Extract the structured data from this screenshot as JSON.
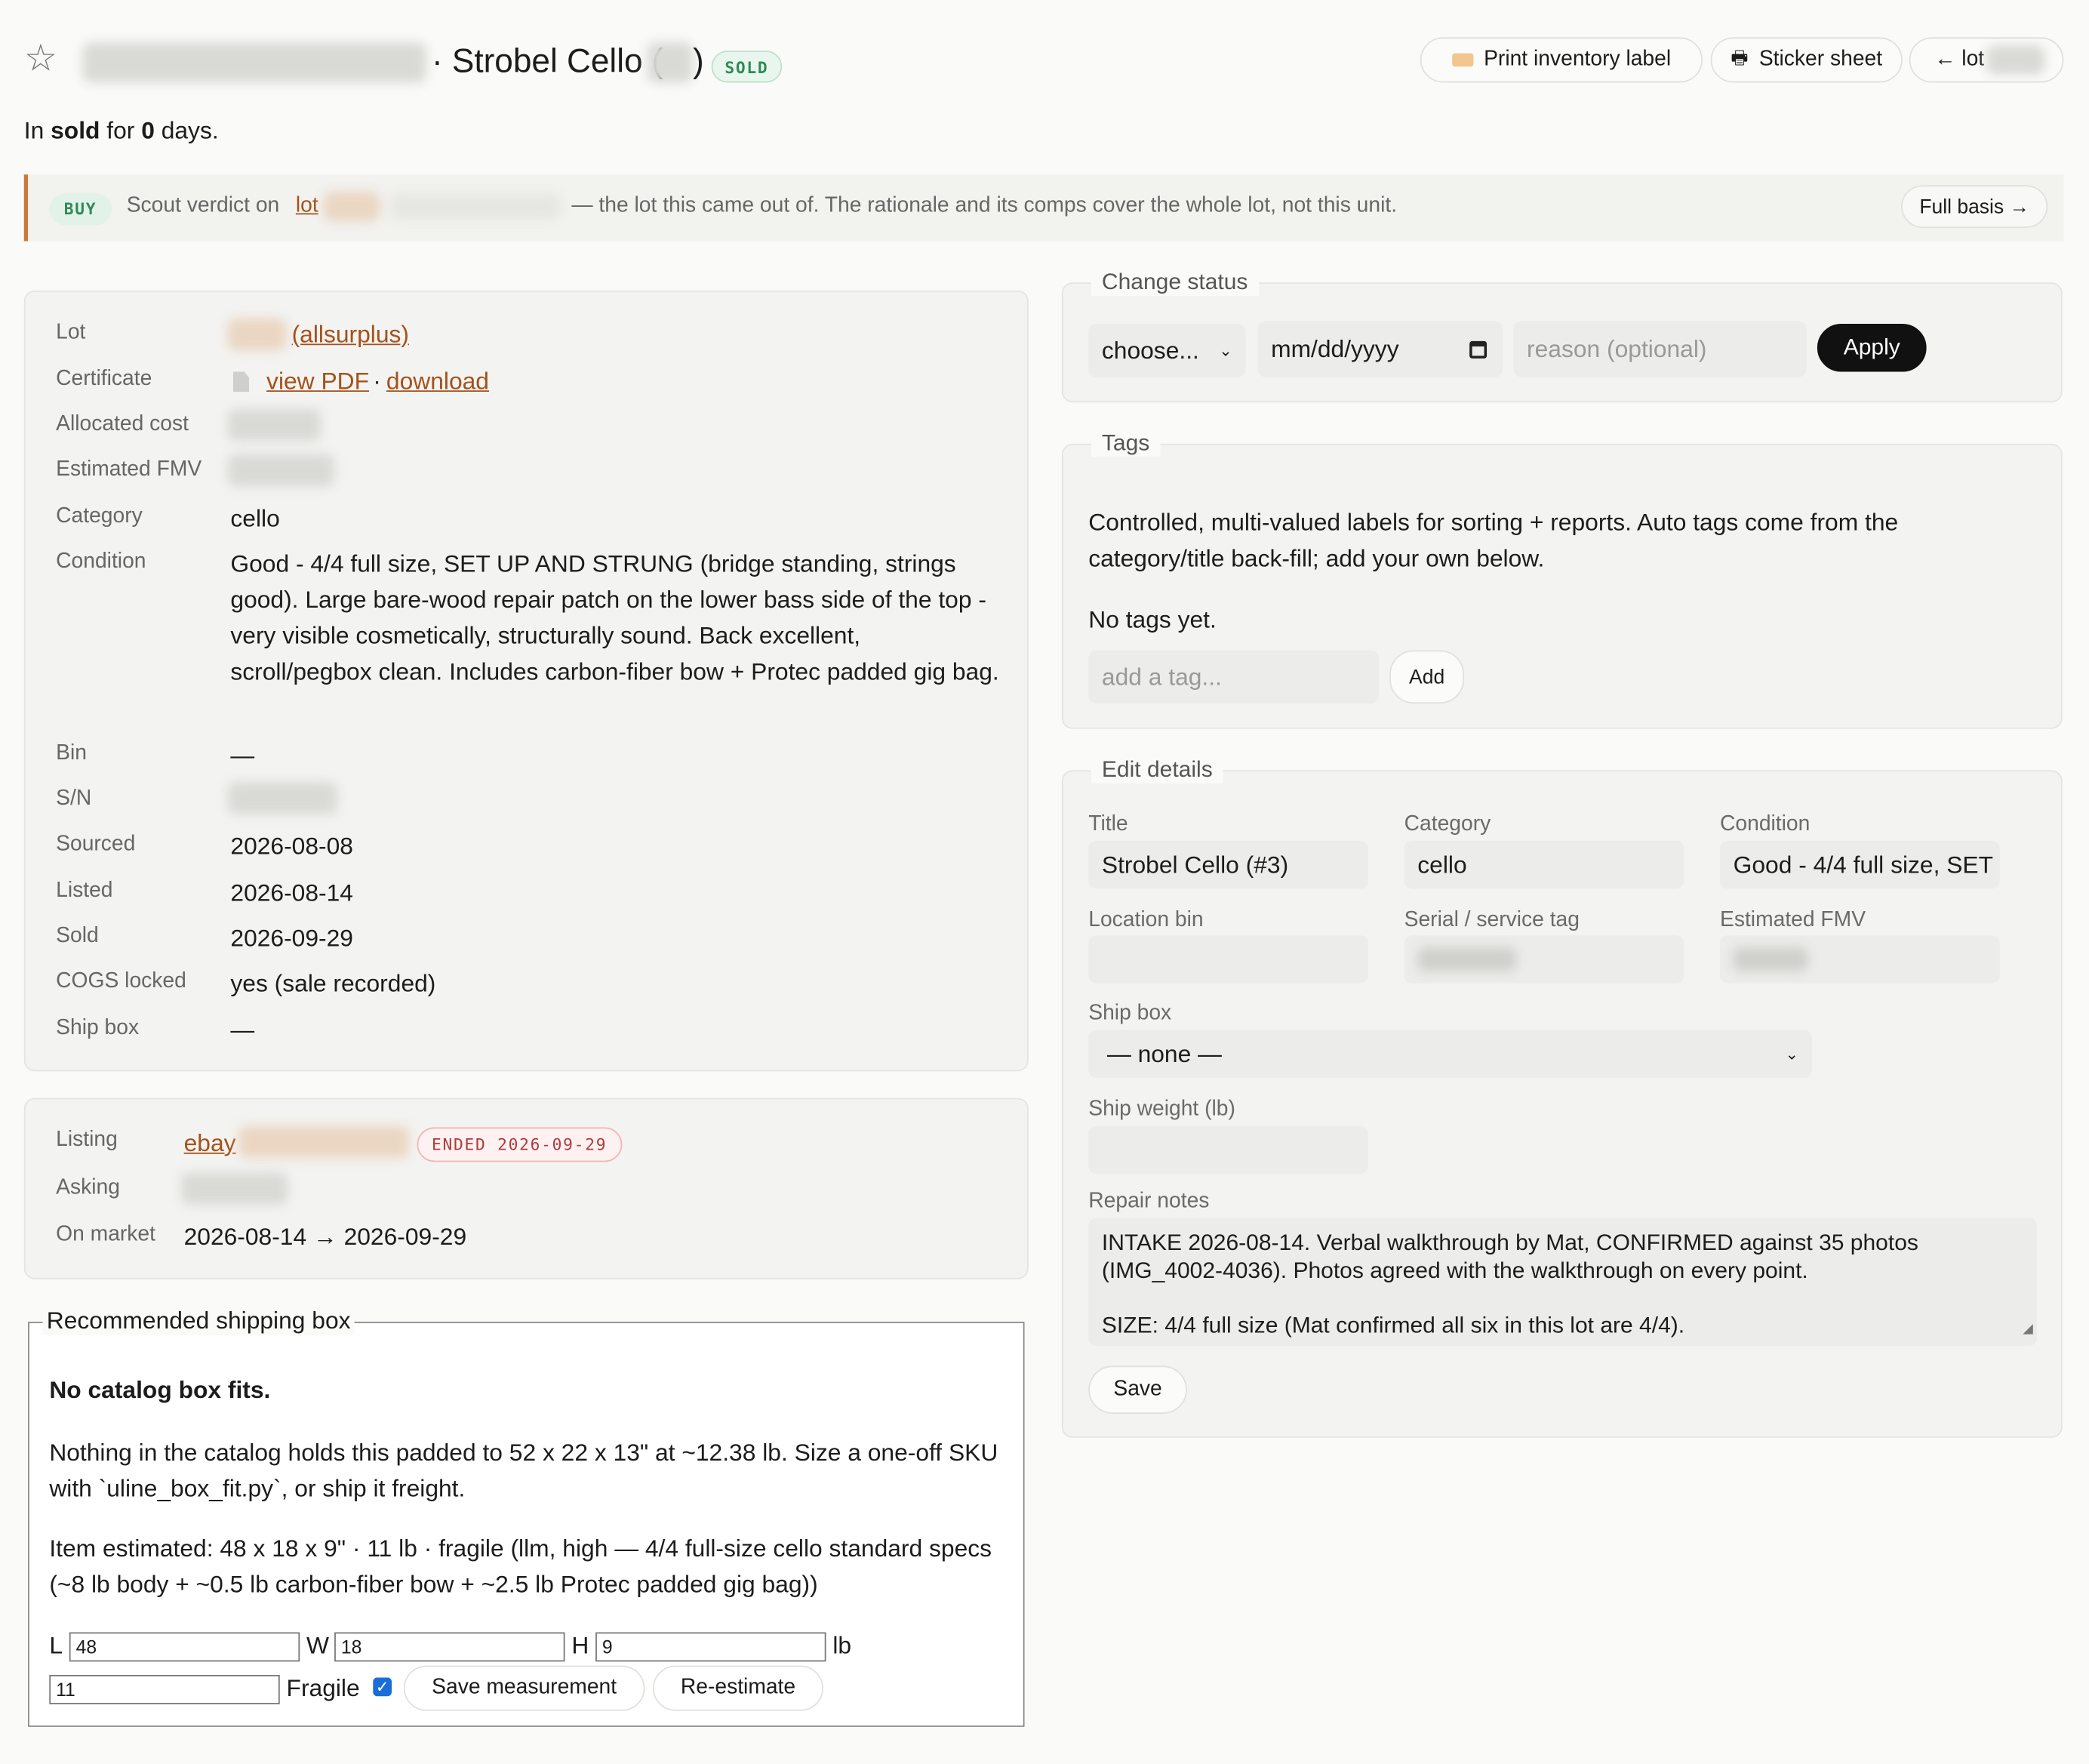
{
  "header": {
    "title": "· Strobel Cello (",
    "title_suffix": ")",
    "status_badge": "SOLD",
    "print_label": "Print inventory label",
    "sticker_sheet": "Sticker sheet",
    "back_lot": "← lot"
  },
  "status_line": {
    "prefix": "In ",
    "status": "sold",
    "middle": " for ",
    "days": "0",
    "suffix": " days."
  },
  "scout": {
    "badge": "BUY",
    "text_prefix": "Scout verdict on ",
    "lot_link": "lot",
    "text_suffix": "— the lot this came out of. The rationale and its comps cover the whole lot, not this unit.",
    "full_basis": "Full basis →"
  },
  "details": {
    "lot_label": "Lot",
    "lot_value": "(allsurplus)",
    "certificate_label": "Certificate",
    "view_pdf": "view PDF",
    "separator": "·",
    "download": "download",
    "allocated_cost_label": "Allocated cost",
    "estimated_fmv_label": "Estimated FMV",
    "category_label": "Category",
    "category_value": "cello",
    "condition_label": "Condition",
    "condition_value": "Good - 4/4 full size, SET UP AND STRUNG (bridge standing, strings good). Large bare-wood repair patch on the lower bass side of the top - very visible cosmetically, structurally sound. Back excellent, scroll/pegbox clean. Includes carbon-fiber bow + Protec padded gig bag.",
    "bin_label": "Bin",
    "bin_value": "—",
    "sn_label": "S/N",
    "sourced_label": "Sourced",
    "sourced_value": "2026-08-08",
    "listed_label": "Listed",
    "listed_value": "2026-08-14",
    "sold_label": "Sold",
    "sold_value": "2026-09-29",
    "cogs_label": "COGS locked",
    "cogs_value": "yes (sale recorded)",
    "shipbox_label": "Ship box",
    "shipbox_value": "—"
  },
  "listing": {
    "listing_label": "Listing",
    "platform": "ebay",
    "ended_badge": "ENDED 2026-09-29",
    "asking_label": "Asking",
    "on_market_label": "On market",
    "on_market_value": "2026-08-14 → 2026-09-29"
  },
  "shipping": {
    "legend": "Recommended shipping box",
    "headline": "No catalog box fits.",
    "para1": "Nothing in the catalog holds this padded to 52 x 22 x 13\" at ~12.38 lb. Size a one-off SKU with `uline_box_fit.py`, or ship it freight.",
    "para2": "Item estimated: 48 x 18 x 9\" · 11 lb · fragile (llm, high — 4/4 full-size cello standard specs (~8 lb body + ~0.5 lb carbon-fiber bow + ~2.5 lb Protec padded gig bag))",
    "l_label": "L",
    "l_value": "48",
    "w_label": "W",
    "w_value": "18",
    "h_label": "H",
    "h_value": "9",
    "lb_label": "lb",
    "lb_value": "11",
    "fragile_label": "Fragile",
    "save_measurement": "Save measurement",
    "re_estimate": "Re-estimate"
  },
  "change_status": {
    "legend": "Change status",
    "select_value": "choose...",
    "date_placeholder": "mm/dd/yyyy",
    "reason_placeholder": "reason (optional)",
    "apply": "Apply"
  },
  "tags": {
    "legend": "Tags",
    "description": "Controlled, multi-valued labels for sorting + reports. Auto tags come from the category/title back-fill; add your own below.",
    "empty": "No tags yet.",
    "input_placeholder": "add a tag...",
    "add": "Add"
  },
  "edit": {
    "legend": "Edit details",
    "title_label": "Title",
    "title_value": "Strobel Cello (#3)",
    "category_label": "Category",
    "category_value": "cello",
    "condition_label": "Condition",
    "condition_value": "Good - 4/4 full size, SET",
    "location_label": "Location bin",
    "serial_label": "Serial / service tag",
    "fmv_label": "Estimated FMV",
    "shipbox_label": "Ship box",
    "shipbox_value": "— none —",
    "weight_label": "Ship weight (lb)",
    "repair_label": "Repair notes",
    "repair_line1": "INTAKE 2026-08-14. Verbal walkthrough by Mat, CONFIRMED against 35 photos",
    "repair_line2": "(IMG_4002-4036). Photos agreed with the walkthrough on every point.",
    "repair_line3": "SIZE: 4/4 full size (Mat confirmed all six in this lot are 4/4).",
    "save": "Save"
  },
  "colors": {
    "accent": "#c97a3a",
    "link": "#a4521a",
    "sold_green": "#2e8b57",
    "ended_red": "#b13a3a",
    "apply_bg": "#111111"
  }
}
